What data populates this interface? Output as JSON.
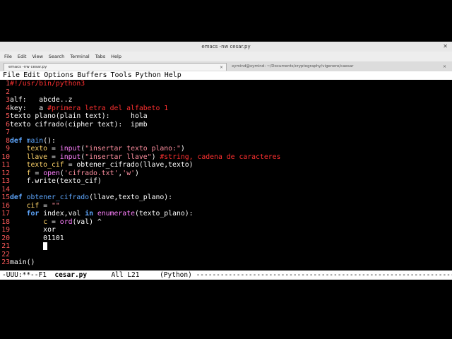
{
  "window": {
    "title": "emacs -nw cesar.py",
    "close_glyph": "✕"
  },
  "menubar": [
    "File",
    "Edit",
    "View",
    "Search",
    "Terminal",
    "Tabs",
    "Help"
  ],
  "tabs": [
    {
      "label": "emacs -nw cesar.py",
      "active": true,
      "close": "×"
    },
    {
      "label": "xymind@xymind: ~/Documents/cryptography/vigenere/caesar",
      "active": false,
      "close": "×"
    }
  ],
  "emacs_menu": [
    "File",
    "Edit",
    "Options",
    "Buffers",
    "Tools",
    "Python",
    "Help"
  ],
  "code_lines": [
    {
      "n": "1",
      "t": "#!/usr/bin/python3"
    },
    {
      "n": "2",
      "t": ""
    },
    {
      "n": "3",
      "t": "alf:   abcde..z"
    },
    {
      "n": "4",
      "t": "key:   a #primera letra del alfabeto 1"
    },
    {
      "n": "5",
      "t": "texto plano(plain text):     hola"
    },
    {
      "n": "6",
      "t": "texto cifrado(cipher text):  ipmb"
    },
    {
      "n": "7",
      "t": ""
    },
    {
      "n": "8",
      "t": "def main():"
    },
    {
      "n": "9",
      "t": "    texto = input(\"insertar texto plano:\")"
    },
    {
      "n": "10",
      "t": "    llave = input(\"insertar llave\") #string, cadena de caracteres"
    },
    {
      "n": "11",
      "t": "    texto_cif = obtener_cifrado(llave,texto)"
    },
    {
      "n": "12",
      "t": "    f = open('cifrado.txt','w')"
    },
    {
      "n": "13",
      "t": "    f.write(texto_cif)"
    },
    {
      "n": "14",
      "t": ""
    },
    {
      "n": "15",
      "t": "def obtener_cifrado(llave,texto_plano):"
    },
    {
      "n": "16",
      "t": "    cif = \"\""
    },
    {
      "n": "17",
      "t": "    for index,val in enumerate(texto_plano):"
    },
    {
      "n": "18",
      "t": "        c = ord(val) ^"
    },
    {
      "n": "19",
      "t": "        xor"
    },
    {
      "n": "20",
      "t": "        01101"
    },
    {
      "n": "21",
      "t": "        "
    },
    {
      "n": "22",
      "t": ""
    },
    {
      "n": "23",
      "t": "main()"
    }
  ],
  "modeline": {
    "prefix": "-UUU:**--F1  ",
    "buffer": "cesar.py",
    "position": "      All L21     (Python) ",
    "fill": "-------------------------------------------------------------------------------------------"
  },
  "colors": {
    "comment": "#ff3030",
    "keyword": "#5fa8ff",
    "string": "#ff8fa0",
    "variable": "#ffd46a",
    "builtin": "#ff80ff"
  }
}
